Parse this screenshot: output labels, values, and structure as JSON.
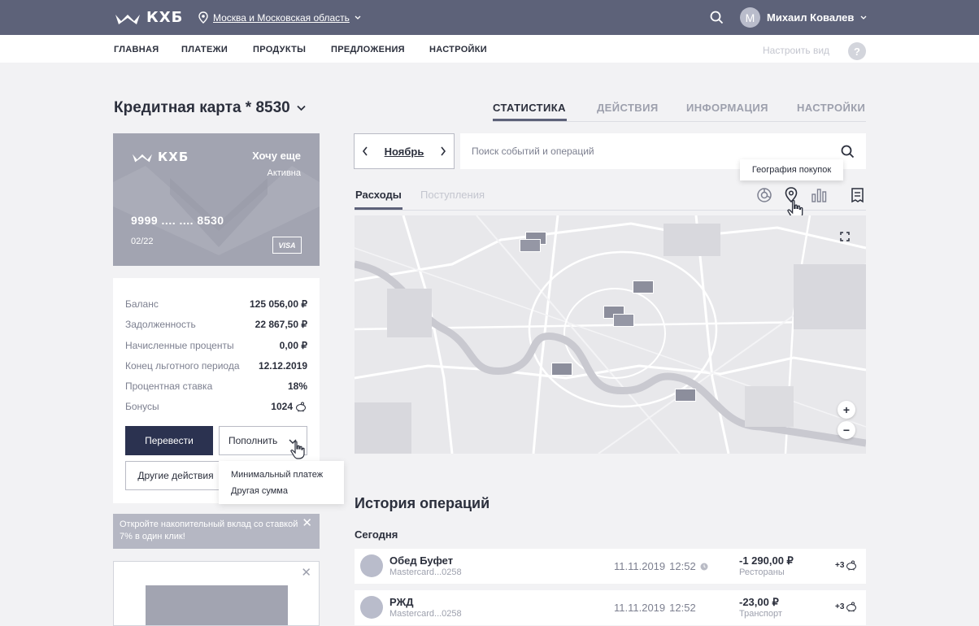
{
  "header": {
    "logo_text": "КХБ",
    "region": "Москва и Московская область",
    "user_initial": "М",
    "user_name": "Михаил Ковалев"
  },
  "nav": {
    "items": [
      "ГЛАВНАЯ",
      "ПЛАТЕЖИ",
      "ПРОДУКТЫ",
      "ПРЕДЛОЖЕНИЯ",
      "НАСТРОЙКИ"
    ],
    "configure_view": "Настроить вид",
    "help": "?"
  },
  "page": {
    "card_title": "Кредитная карта * 8530",
    "tabs": [
      "СТАТИСТИКА",
      "ДЕЙСТВИЯ",
      "ИНФОРМАЦИЯ",
      "НАСТРОЙКИ"
    ],
    "active_tab": "СТАТИСТИКА"
  },
  "card": {
    "logo_text": "КХБ",
    "name": "Хочу еще",
    "status": "Активна",
    "number": "9999 .... .... 8530",
    "expiry": "02/22",
    "network": "VISA"
  },
  "info": {
    "rows": [
      {
        "label": "Баланс",
        "value": "125 056,00 ₽"
      },
      {
        "label": "Задолженность",
        "value": "22 867,50 ₽"
      },
      {
        "label": "Начисленные проценты",
        "value": "0,00 ₽"
      },
      {
        "label": "Конец льготного периода",
        "value": "12.12.2019"
      },
      {
        "label": "Процентная ставка",
        "value": "18%"
      },
      {
        "label": "Бонусы",
        "value": "1024"
      }
    ],
    "transfer_label": "Перевести",
    "topup_label": "Пополнить",
    "other_label": "Другие действия",
    "topup_options": [
      "Минимальный платеж",
      "Другая сумма"
    ]
  },
  "promo": {
    "text": "Откройте накопительный вклад со ставкой 7% в один клик!"
  },
  "stats": {
    "month": "Ноябрь",
    "search_placeholder": "Поиск событий и операций",
    "tooltip": "География покупок",
    "sub_tabs": [
      "Расходы",
      "Поступления"
    ],
    "active_sub_tab": "Расходы",
    "view_icons": [
      "donut-chart-icon",
      "map-pin-icon",
      "bar-chart-icon",
      "report-icon"
    ]
  },
  "map": {
    "zoom_in": "+",
    "zoom_out": "−"
  },
  "history": {
    "title": "История операций",
    "group_today": "Сегодня",
    "transactions": [
      {
        "name": "Обед Буфет",
        "card": "Mastercard...0258",
        "date": "11.11.2019",
        "time": "12:52",
        "amount": "-1 290,00 ₽",
        "category": "Рестораны",
        "bonus": "+3",
        "pending": true
      },
      {
        "name": "РЖД",
        "card": "Mastercard...0258",
        "date": "11.11.2019",
        "time": "12:52",
        "amount": "-23,00 ₽",
        "category": "Транспорт",
        "bonus": "+3",
        "pending": false
      }
    ]
  },
  "colors": {
    "header_bg": "#5d6279",
    "primary_button": "#2b3250",
    "card_bg": "#a2a4b1",
    "page_bg": "#f2f2f4"
  }
}
